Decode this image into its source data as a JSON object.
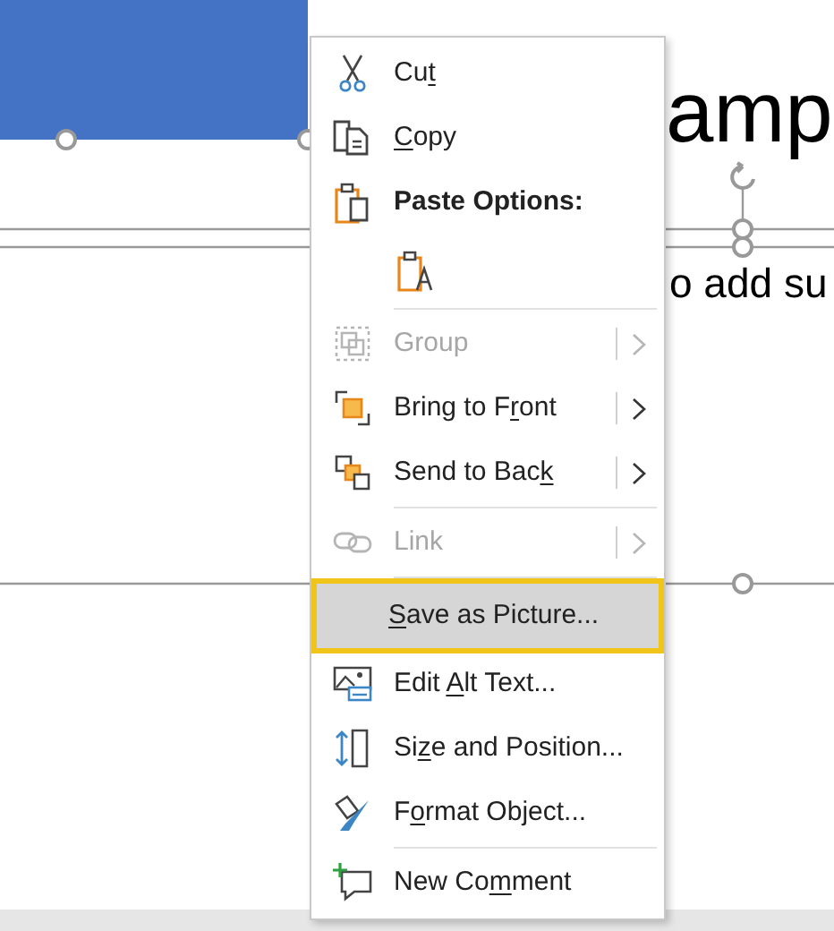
{
  "slide": {
    "title_fragment": "amp",
    "subtitle_fragment": "o add su"
  },
  "context_menu": {
    "items": [
      {
        "kind": "item",
        "label": {
          "before": "Cu",
          "key": "t"
        },
        "disabled": false,
        "submenu": false,
        "selected": false
      },
      {
        "kind": "item",
        "label": {
          "key": "C",
          "after": "opy"
        },
        "disabled": false,
        "submenu": false,
        "selected": false
      },
      {
        "kind": "heading",
        "label": {
          "before": "Paste Options:"
        }
      },
      {
        "kind": "paste_option"
      },
      {
        "kind": "separator"
      },
      {
        "kind": "item",
        "label": {
          "before": "Group"
        },
        "disabled": true,
        "submenu": true,
        "selected": false
      },
      {
        "kind": "item",
        "label": {
          "before": "Bring to F",
          "key": "r",
          "after": "ont"
        },
        "disabled": false,
        "submenu": true,
        "selected": false
      },
      {
        "kind": "item",
        "label": {
          "before": "Send to Bac",
          "key": "k"
        },
        "disabled": false,
        "submenu": true,
        "selected": false
      },
      {
        "kind": "separator"
      },
      {
        "kind": "item",
        "label": {
          "before": "Link"
        },
        "disabled": true,
        "submenu": true,
        "selected": false
      },
      {
        "kind": "separator"
      },
      {
        "kind": "item",
        "label": {
          "key": "S",
          "after": "ave as Picture..."
        },
        "disabled": false,
        "submenu": false,
        "selected": true
      },
      {
        "kind": "item",
        "label": {
          "before": "Edit ",
          "key": "A",
          "after": "lt Text..."
        },
        "disabled": false,
        "submenu": false,
        "selected": false
      },
      {
        "kind": "item",
        "label": {
          "before": "Si",
          "key": "z",
          "after": "e and Position..."
        },
        "disabled": false,
        "submenu": false,
        "selected": false
      },
      {
        "kind": "item",
        "label": {
          "before": "F",
          "key": "o",
          "after": "rmat Object..."
        },
        "disabled": false,
        "submenu": false,
        "selected": false
      },
      {
        "kind": "separator"
      },
      {
        "kind": "item",
        "label": {
          "before": "New Co",
          "key": "m",
          "after": "ment"
        },
        "disabled": false,
        "submenu": false,
        "selected": false
      }
    ]
  }
}
